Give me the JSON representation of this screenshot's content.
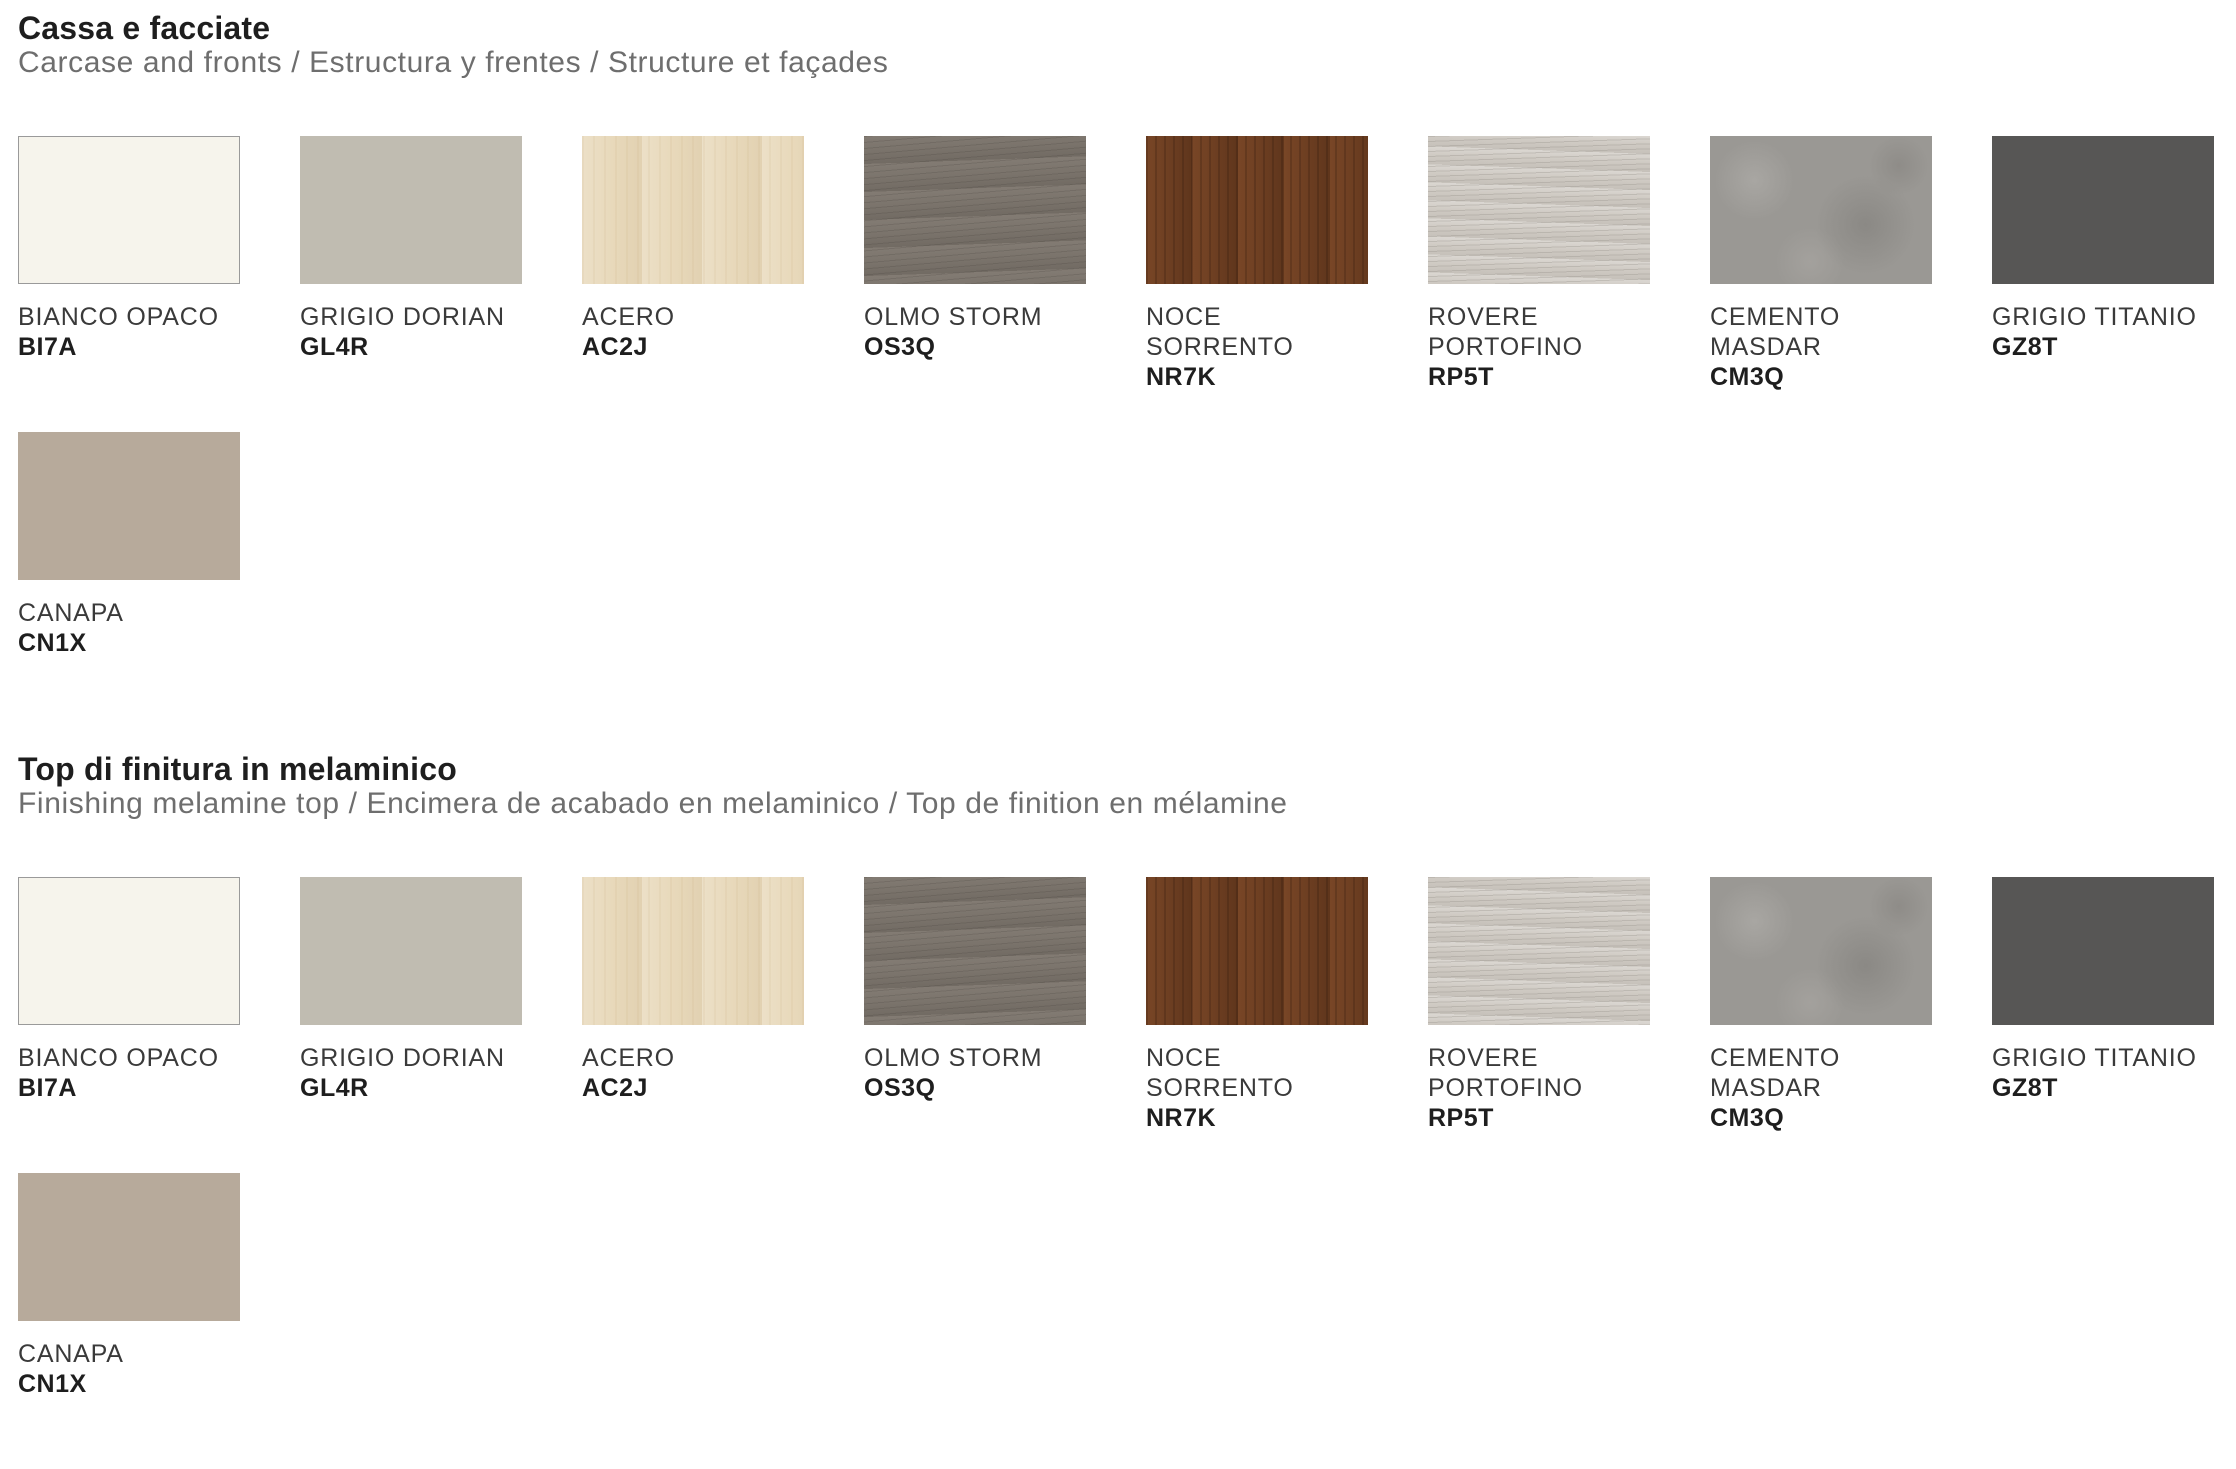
{
  "sections": [
    {
      "title": "Cassa e facciate",
      "subtitle": "Carcase and fronts / Estructura y frentes / Structure et façades",
      "finishes": [
        {
          "name": "BIANCO OPACO",
          "code": "BI7A",
          "color": "#f6f4ec",
          "texture": "plain",
          "bordered": true
        },
        {
          "name": "GRIGIO DORIAN",
          "code": "GL4R",
          "color": "#c0bcb1",
          "texture": "plain",
          "bordered": false
        },
        {
          "name": "ACERO",
          "code": "AC2J",
          "color": "#e8d9bb",
          "texture": "light-wood",
          "bordered": false
        },
        {
          "name": "OLMO STORM",
          "code": "OS3Q",
          "color": "#7b746c",
          "texture": "grey-wood",
          "bordered": false
        },
        {
          "name": "NOCE\nSORRENTO",
          "code": "NR7K",
          "color": "#6e3f22",
          "texture": "dark-wood",
          "bordered": false
        },
        {
          "name": "ROVERE\nPORTOFINO",
          "code": "RP5T",
          "color": "#cfcac3",
          "texture": "pale-oak",
          "bordered": false
        },
        {
          "name": "CEMENTO\nMASDAR",
          "code": "CM3Q",
          "color": "#9a9894",
          "texture": "concrete",
          "bordered": false
        },
        {
          "name": "GRIGIO TITANIO",
          "code": "GZ8T",
          "color": "#575655",
          "texture": "plain",
          "bordered": false
        },
        {
          "name": "CANAPA",
          "code": "CN1X",
          "color": "#b7aa9b",
          "texture": "plain",
          "bordered": false
        }
      ]
    },
    {
      "title": "Top di finitura in melaminico",
      "subtitle": "Finishing melamine top / Encimera de acabado en melaminico / Top de finition en mélamine",
      "finishes": [
        {
          "name": "BIANCO OPACO",
          "code": "BI7A",
          "color": "#f6f4ec",
          "texture": "plain",
          "bordered": true
        },
        {
          "name": "GRIGIO DORIAN",
          "code": "GL4R",
          "color": "#c0bcb1",
          "texture": "plain",
          "bordered": false
        },
        {
          "name": "ACERO",
          "code": "AC2J",
          "color": "#e8d9bb",
          "texture": "light-wood",
          "bordered": false
        },
        {
          "name": "OLMO STORM",
          "code": "OS3Q",
          "color": "#7b746c",
          "texture": "grey-wood",
          "bordered": false
        },
        {
          "name": "NOCE\nSORRENTO",
          "code": "NR7K",
          "color": "#6e3f22",
          "texture": "dark-wood",
          "bordered": false
        },
        {
          "name": "ROVERE\nPORTOFINO",
          "code": "RP5T",
          "color": "#cfcac3",
          "texture": "pale-oak",
          "bordered": false
        },
        {
          "name": "CEMENTO\nMASDAR",
          "code": "CM3Q",
          "color": "#9a9894",
          "texture": "concrete",
          "bordered": false
        },
        {
          "name": "GRIGIO TITANIO",
          "code": "GZ8T",
          "color": "#575655",
          "texture": "plain",
          "bordered": false
        },
        {
          "name": "CANAPA",
          "code": "CN1X",
          "color": "#b7aa9b",
          "texture": "plain",
          "bordered": false
        }
      ]
    }
  ]
}
